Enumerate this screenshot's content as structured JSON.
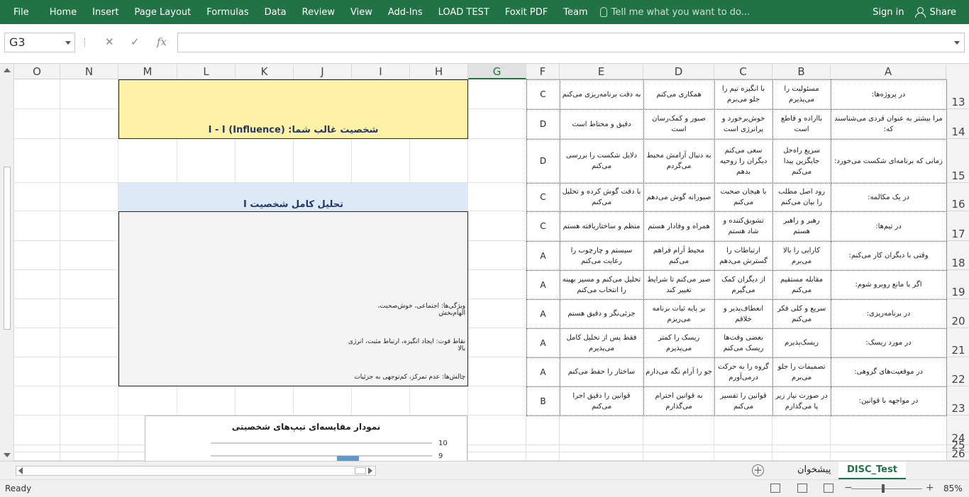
{
  "ribbon": {
    "tabs": [
      "File",
      "Home",
      "Insert",
      "Page Layout",
      "Formulas",
      "Data",
      "Review",
      "View",
      "Add-Ins",
      "LOAD TEST",
      "Foxit PDF",
      "Team"
    ],
    "tell_me": "Tell me what you want to do...",
    "sign_in": "Sign in",
    "share": "Share"
  },
  "formula_bar": {
    "name_box": "G3",
    "cancel": "✕",
    "enter": "✓",
    "fx": "fx",
    "formula": ""
  },
  "columns": [
    "O",
    "N",
    "M",
    "L",
    "K",
    "J",
    "I",
    "H",
    "G",
    "F",
    "E",
    "D",
    "C",
    "B",
    "A"
  ],
  "selected_column": "G",
  "rows": [
    "13",
    "14",
    "15",
    "16",
    "17",
    "18",
    "19",
    "20",
    "21",
    "22",
    "23",
    "24",
    "25",
    "26"
  ],
  "questions": [
    {
      "a": "در پروژه‌ها:",
      "b": "مسئولیت را می‌پذیرم",
      "c": "با انگیزه تیم را جلو می‌برم",
      "d": "همکاری می‌کنم",
      "e": "به دقت برنامه‌ریزی می‌کنم",
      "f": "C"
    },
    {
      "a": "مرا بیشتر به عنوان فردی می‌شناسند که:",
      "b": "بااراده و قاطع است",
      "c": "خوش‌برخورد و پرانرژی است",
      "d": "صبور و کمک‌رسان است",
      "e": "دقیق و محتاط است",
      "f": "D"
    },
    {
      "a": "زمانی که برنامه‌ای شکست می‌خورد:",
      "b": "سریع راه‌حل جایگزین پیدا می‌کنم",
      "c": "سعی می‌کنم دیگران را روحیه بدهم",
      "d": "به دنبال آرامش محیط می‌گردم",
      "e": "دلایل شکست را بررسی می‌کنم",
      "f": "D"
    },
    {
      "a": "در یک مکالمه:",
      "b": "رود اصل مطلب را بیان می‌کنم",
      "c": "با هیجان صحبت می‌کنم",
      "d": "صبورانه گوش می‌دهم",
      "e": "با دقت گوش کرده و تحلیل می‌کنم",
      "f": "C"
    },
    {
      "a": "در تیم‌ها:",
      "b": "رهبر و راهبر هستم",
      "c": "تشویق‌کننده و شاد هستم",
      "d": "همراه و وفادار هستم",
      "e": "منظم و ساختاریافته هستم",
      "f": "C"
    },
    {
      "a": "وقتی با دیگران کار می‌کنم:",
      "b": "کارایی را بالا می‌برم",
      "c": "ارتباطات را گسترش می‌دهم",
      "d": "محیط آرام فراهم می‌کنم",
      "e": "سیستم و چارچوب را رعایت می‌کنم",
      "f": "A"
    },
    {
      "a": "اگر با مانع روبرو شوم:",
      "b": "مقابله مستقیم می‌کنم",
      "c": "از دیگران کمک می‌گیرم",
      "d": "صبر می‌کنم تا شرایط تغییر کند",
      "e": "تحلیل می‌کنم و مسیر بهینه را انتخاب می‌کنم",
      "f": "A"
    },
    {
      "a": "در برنامه‌ریزی:",
      "b": "سریع و کلی فکر می‌کنم",
      "c": "انعطاف‌پذیر و خلاقم",
      "d": "بر پایه ثبات برنامه می‌ریزم",
      "e": "جزئی‌نگر و دقیق هستم",
      "f": "A"
    },
    {
      "a": "در مورد ریسک:",
      "b": "ریسک‌پذیرم",
      "c": "بعضی وقت‌ها ریسک می‌کنم",
      "d": "ریسک را کمتر می‌پذیرم",
      "e": "فقط پس از تحلیل کامل می‌پذیرم",
      "f": "A"
    },
    {
      "a": "در موقعیت‌های گروهی:",
      "b": "تصمیمات را جلو می‌برم",
      "c": "گروه را به حرکت درمی‌آورم",
      "d": "جو را آرام نگه می‌دارم",
      "e": "ساختار را حفظ می‌کنم",
      "f": "A"
    },
    {
      "a": "در مواجهه با قوانین:",
      "b": "در صورت نیاز زیر پا می‌گذارم",
      "c": "قوانین را تفسیر می‌کنم",
      "d": "به قوانین احترام می‌گذارم",
      "e": "قوانین را دقیق اجرا می‌کنم",
      "f": "B"
    }
  ],
  "result": {
    "dominant_title": "شخصیت غالب شما: (Influence) I - I",
    "analysis_title": "تحلیل کامل شخصیت I",
    "traits": "ویژگی‌ها: اجتماعی، خوش‌صحبت، الهام‌بخش",
    "strengths": "نقاط قوت: ایجاد انگیزه، ارتباط مثبت، انرژی بالا",
    "challenges": "چالش‌ها: عدم تمرکز، کم‌توجهی به جزئیات"
  },
  "chart_data": {
    "type": "bar",
    "title": "نمودار مقایسه‌ای تیپ‌های شخصیتی",
    "y_ticks": [
      "10",
      "9"
    ]
  },
  "sheets": [
    "پیشخوان",
    "DISC_Test"
  ],
  "active_sheet": "DISC_Test",
  "status": {
    "ready": "Ready",
    "zoom": "85%"
  }
}
